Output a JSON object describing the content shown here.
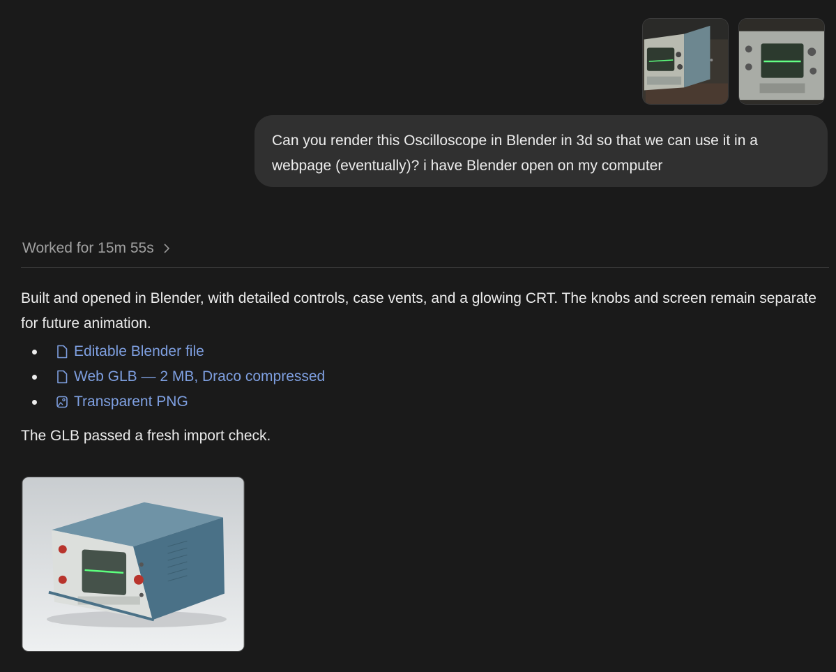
{
  "user_message": {
    "text": "Can you render this Oscilloscope in Blender in 3d so that we can use it in a webpage (eventually)? i have Blender open on my computer",
    "attachments": [
      {
        "icon": "oscilloscope-photo-side"
      },
      {
        "icon": "oscilloscope-photo-front"
      }
    ]
  },
  "assistant": {
    "worked_label": "Worked for 15m 55s",
    "summary": "Built and opened in Blender, with detailed controls, case vents, and a glowing CRT. The knobs and screen remain separate for future animation.",
    "files": [
      {
        "label": "Editable Blender file",
        "icon": "file-icon"
      },
      {
        "label": "Web GLB — 2 MB, Draco compressed",
        "icon": "file-icon"
      },
      {
        "label": "Transparent PNG",
        "icon": "image-icon"
      }
    ],
    "closing": "The GLB passed a fresh import check.",
    "preview_image": {
      "icon": "oscilloscope-render"
    }
  },
  "colors": {
    "background": "#1a1a1a",
    "bubble": "#303030",
    "link": "#7e9fe0",
    "muted": "#a0a0a0",
    "trace": "#4cff7a"
  }
}
